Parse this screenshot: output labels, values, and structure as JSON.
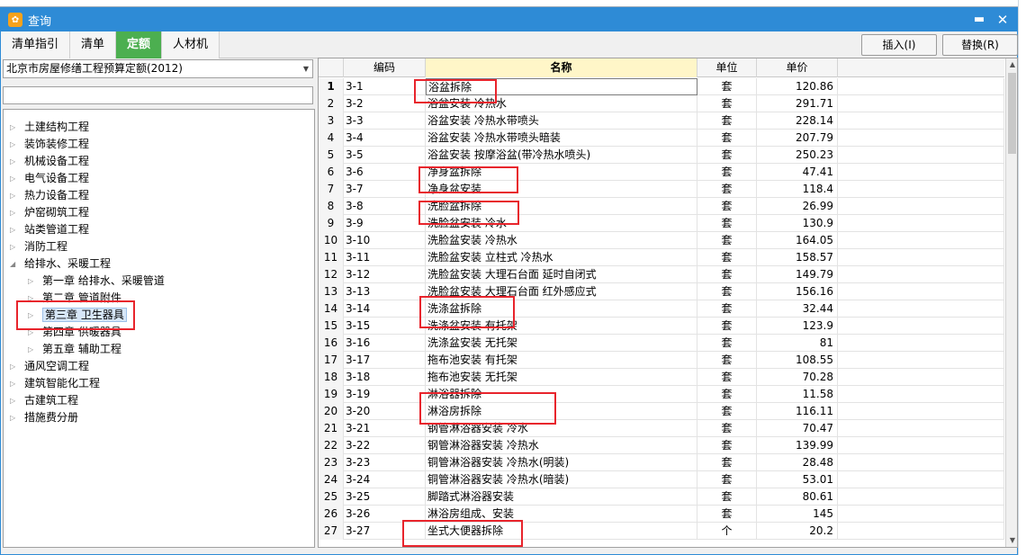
{
  "window": {
    "title": "查询",
    "min_label": "▬",
    "close_label": "✕"
  },
  "tabs": [
    {
      "label": "清单指引"
    },
    {
      "label": "清单"
    },
    {
      "label": "定额"
    },
    {
      "label": "人材机"
    }
  ],
  "active_tab": "定额",
  "actions": {
    "insert_label": "插入(I)",
    "replace_label": "替换(R)"
  },
  "quota_select": {
    "value": "北京市房屋修缮工程预算定额(2012)"
  },
  "tree": [
    {
      "label": "土建结构工程",
      "level": 0,
      "expanded": false
    },
    {
      "label": "装饰装修工程",
      "level": 0,
      "expanded": false
    },
    {
      "label": "机械设备工程",
      "level": 0,
      "expanded": false
    },
    {
      "label": "电气设备工程",
      "level": 0,
      "expanded": false
    },
    {
      "label": "热力设备工程",
      "level": 0,
      "expanded": false
    },
    {
      "label": "炉窑砌筑工程",
      "level": 0,
      "expanded": false
    },
    {
      "label": "站类管道工程",
      "level": 0,
      "expanded": false
    },
    {
      "label": "消防工程",
      "level": 0,
      "expanded": false
    },
    {
      "label": "给排水、采暖工程",
      "level": 0,
      "expanded": true
    },
    {
      "label": "第一章 给排水、采暖管道",
      "level": 1,
      "expanded": false
    },
    {
      "label": "第二章 管道附件",
      "level": 1,
      "expanded": false
    },
    {
      "label": "第三章 卫生器具",
      "level": 1,
      "expanded": false,
      "selected": true
    },
    {
      "label": "第四章 供暖器具",
      "level": 1,
      "expanded": false
    },
    {
      "label": "第五章 辅助工程",
      "level": 1,
      "expanded": false
    },
    {
      "label": "通风空调工程",
      "level": 0,
      "expanded": false
    },
    {
      "label": "建筑智能化工程",
      "level": 0,
      "expanded": false
    },
    {
      "label": "古建筑工程",
      "level": 0,
      "expanded": false
    },
    {
      "label": "措施费分册",
      "level": 0,
      "expanded": false
    }
  ],
  "grid": {
    "headers": {
      "code": "编码",
      "name": "名称",
      "unit": "单位",
      "price": "单价"
    },
    "rows": [
      {
        "idx": "1",
        "code": "3-1",
        "name": "浴盆拆除",
        "unit": "套",
        "price": "120.86"
      },
      {
        "idx": "2",
        "code": "3-2",
        "name": "浴盆安装 冷热水",
        "unit": "套",
        "price": "291.71"
      },
      {
        "idx": "3",
        "code": "3-3",
        "name": "浴盆安装 冷热水带喷头",
        "unit": "套",
        "price": "228.14"
      },
      {
        "idx": "4",
        "code": "3-4",
        "name": "浴盆安装 冷热水带喷头暗装",
        "unit": "套",
        "price": "207.79"
      },
      {
        "idx": "5",
        "code": "3-5",
        "name": "浴盆安装 按摩浴盆(带冷热水喷头)",
        "unit": "套",
        "price": "250.23"
      },
      {
        "idx": "6",
        "code": "3-6",
        "name": "净身盆拆除",
        "unit": "套",
        "price": "47.41"
      },
      {
        "idx": "7",
        "code": "3-7",
        "name": "净身盆安装",
        "unit": "套",
        "price": "118.4"
      },
      {
        "idx": "8",
        "code": "3-8",
        "name": "洗脸盆拆除",
        "unit": "套",
        "price": "26.99"
      },
      {
        "idx": "9",
        "code": "3-9",
        "name": "洗脸盆安装 冷水",
        "unit": "套",
        "price": "130.9"
      },
      {
        "idx": "10",
        "code": "3-10",
        "name": "洗脸盆安装 冷热水",
        "unit": "套",
        "price": "164.05"
      },
      {
        "idx": "11",
        "code": "3-11",
        "name": "洗脸盆安装 立柱式 冷热水",
        "unit": "套",
        "price": "158.57"
      },
      {
        "idx": "12",
        "code": "3-12",
        "name": "洗脸盆安装 大理石台面 延时自闭式",
        "unit": "套",
        "price": "149.79"
      },
      {
        "idx": "13",
        "code": "3-13",
        "name": "洗脸盆安装 大理石台面 红外感应式",
        "unit": "套",
        "price": "156.16"
      },
      {
        "idx": "14",
        "code": "3-14",
        "name": "洗涤盆拆除",
        "unit": "套",
        "price": "32.44"
      },
      {
        "idx": "15",
        "code": "3-15",
        "name": "洗涤盆安装 有托架",
        "unit": "套",
        "price": "123.9"
      },
      {
        "idx": "16",
        "code": "3-16",
        "name": "洗涤盆安装 无托架",
        "unit": "套",
        "price": "81"
      },
      {
        "idx": "17",
        "code": "3-17",
        "name": "拖布池安装 有托架",
        "unit": "套",
        "price": "108.55"
      },
      {
        "idx": "18",
        "code": "3-18",
        "name": "拖布池安装 无托架",
        "unit": "套",
        "price": "70.28"
      },
      {
        "idx": "19",
        "code": "3-19",
        "name": "淋浴器拆除",
        "unit": "套",
        "price": "11.58"
      },
      {
        "idx": "20",
        "code": "3-20",
        "name": "淋浴房拆除",
        "unit": "套",
        "price": "116.11"
      },
      {
        "idx": "21",
        "code": "3-21",
        "name": "钢管淋浴器安装 冷水",
        "unit": "套",
        "price": "70.47"
      },
      {
        "idx": "22",
        "code": "3-22",
        "name": "钢管淋浴器安装 冷热水",
        "unit": "套",
        "price": "139.99"
      },
      {
        "idx": "23",
        "code": "3-23",
        "name": "铜管淋浴器安装 冷热水(明装)",
        "unit": "套",
        "price": "28.48"
      },
      {
        "idx": "24",
        "code": "3-24",
        "name": "铜管淋浴器安装 冷热水(暗装)",
        "unit": "套",
        "price": "53.01"
      },
      {
        "idx": "25",
        "code": "3-25",
        "name": "脚踏式淋浴器安装",
        "unit": "套",
        "price": "80.61"
      },
      {
        "idx": "26",
        "code": "3-26",
        "name": "淋浴房组成、安装",
        "unit": "套",
        "price": "145"
      },
      {
        "idx": "27",
        "code": "3-27",
        "name": "坐式大便器拆除",
        "unit": "个",
        "price": "20.2"
      }
    ]
  },
  "colors": {
    "titlebar": "#2e8bd6",
    "active_tab": "#4caf50",
    "name_header": "#fff6c8",
    "highlight": "#e8242c"
  }
}
